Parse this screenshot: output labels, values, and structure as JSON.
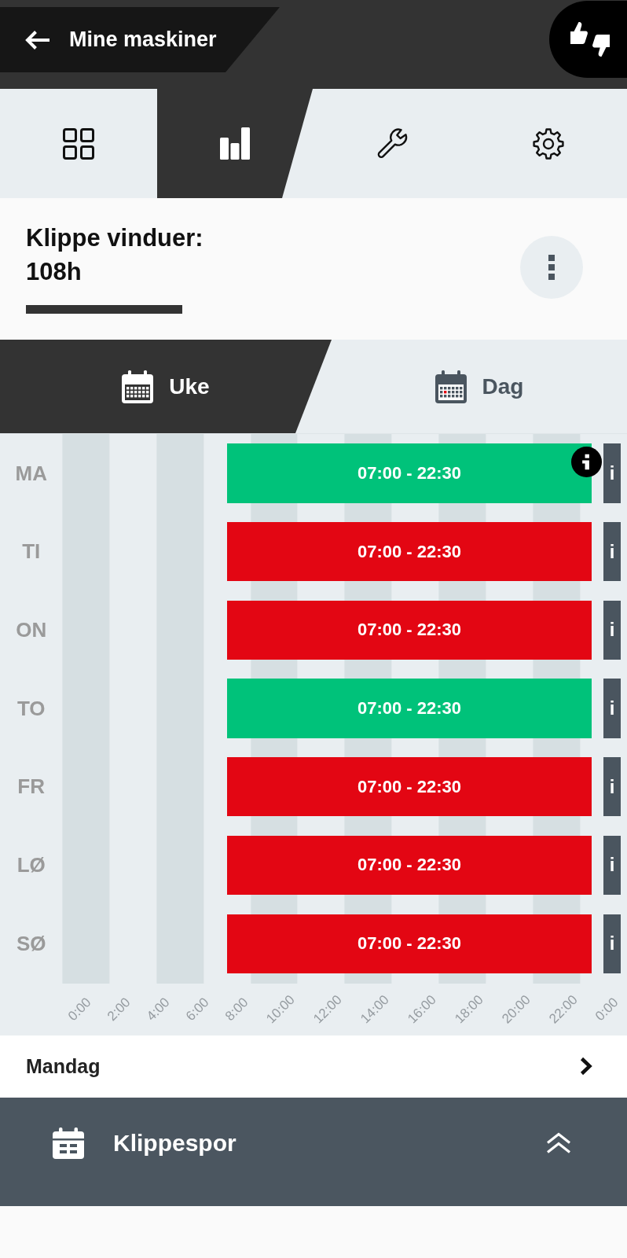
{
  "header": {
    "title": "Mine maskiner"
  },
  "nav_tabs": [
    {
      "kind": "grid",
      "selected": false
    },
    {
      "kind": "chart",
      "selected": true
    },
    {
      "kind": "wrench",
      "selected": false
    },
    {
      "kind": "gear",
      "selected": false
    }
  ],
  "summary": {
    "title": "Klippe vinduer:",
    "value": "108h"
  },
  "view_tabs": [
    {
      "kind": "week",
      "label": "Uke",
      "selected": true
    },
    {
      "kind": "day",
      "label": "Dag",
      "selected": false
    }
  ],
  "schedule": {
    "days": [
      {
        "label": "MA",
        "window": "07:00 - 22:30",
        "color": "#00c27a",
        "info": "i",
        "selected": true
      },
      {
        "label": "TI",
        "window": "07:00 - 22:30",
        "color": "#e30613",
        "info": "i",
        "selected": false
      },
      {
        "label": "ON",
        "window": "07:00 - 22:30",
        "color": "#e30613",
        "info": "i",
        "selected": false
      },
      {
        "label": "TO",
        "window": "07:00 - 22:30",
        "color": "#00c27a",
        "info": "i",
        "selected": false
      },
      {
        "label": "FR",
        "window": "07:00 - 22:30",
        "color": "#e30613",
        "info": "i",
        "selected": false
      },
      {
        "label": "LØ",
        "window": "07:00 - 22:30",
        "color": "#e30613",
        "info": "i",
        "selected": false
      },
      {
        "label": "SØ",
        "window": "07:00 - 22:30",
        "color": "#e30613",
        "info": "i",
        "selected": false
      }
    ],
    "time_labels": [
      "0:00",
      "2:00",
      "4:00",
      "6:00",
      "8:00",
      "10:00",
      "12:00",
      "14:00",
      "16:00",
      "18:00",
      "20:00",
      "22:00",
      "0:00"
    ]
  },
  "day_row": {
    "label": "Mandag"
  },
  "panel": {
    "title": "Klippespor",
    "expanded": false
  }
}
